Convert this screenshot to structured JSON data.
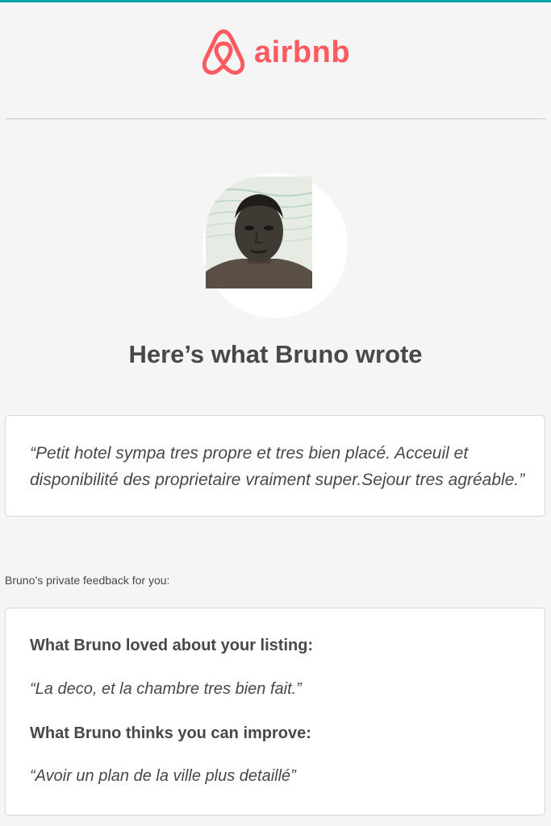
{
  "brand": {
    "name": "airbnb",
    "color": "#ff5a5f"
  },
  "avatar": {
    "icon": "host-guest-photo"
  },
  "headline": "Here’s what Bruno wrote",
  "review": {
    "text": "“Petit hotel sympa tres propre et tres bien placé. Acceuil et disponibilité des proprietaire vraiment super.Sejour tres agréable.”"
  },
  "private_feedback": {
    "label": "Bruno’s private feedback for you:",
    "loved_heading": "What Bruno loved about your listing:",
    "loved_text": "“La deco, et la chambre tres bien fait.”",
    "improve_heading": "What Bruno thinks you can improve:",
    "improve_text": "“Avoir un plan de la ville plus detaillé”"
  }
}
